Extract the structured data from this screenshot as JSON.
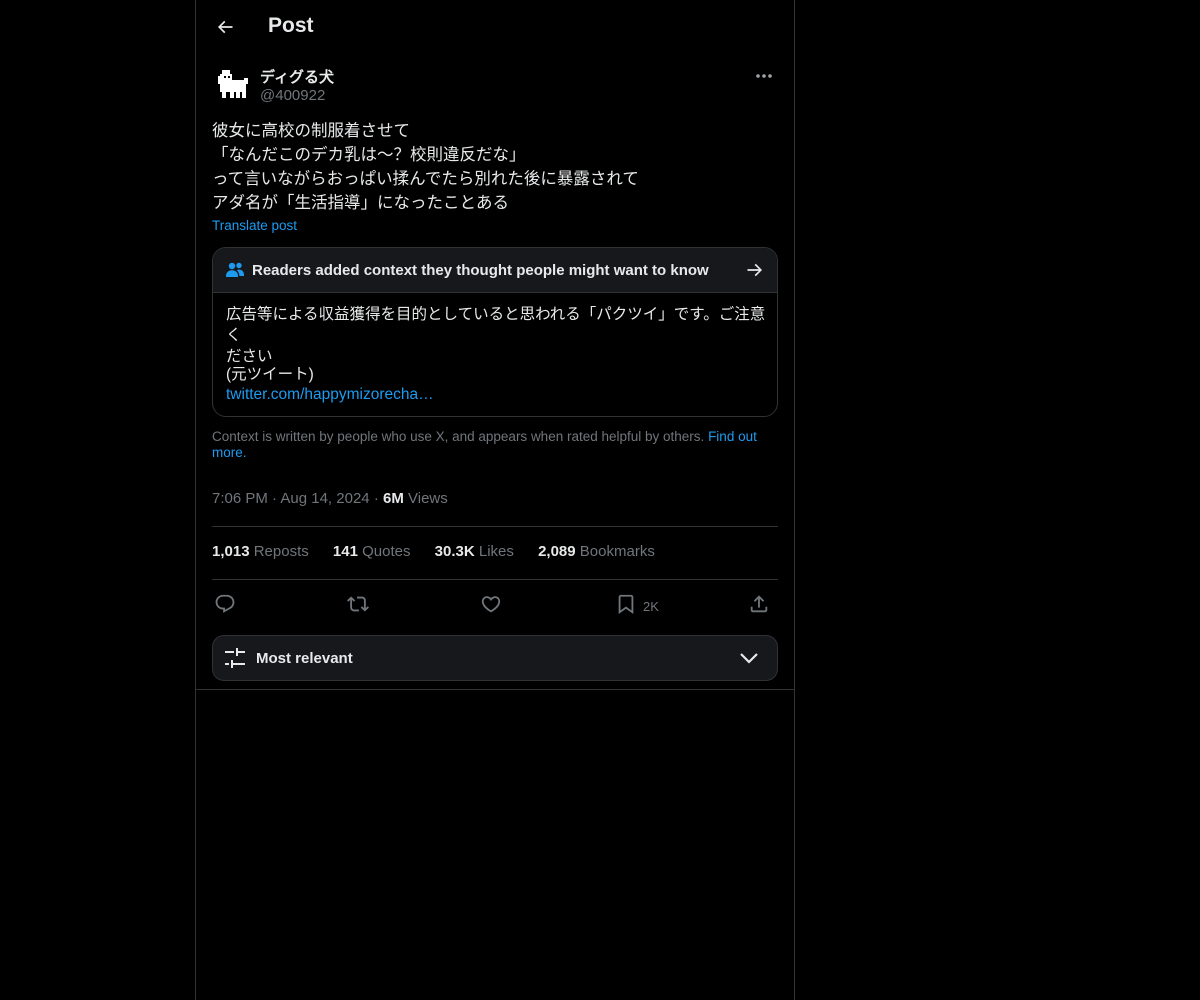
{
  "header": {
    "title": "Post",
    "back_icon": "arrow-left-icon"
  },
  "author": {
    "display_name": "ディグる犬",
    "handle": "@400922",
    "avatar_icon": "pixel-dog-avatar"
  },
  "post": {
    "lines": [
      "彼女に高校の制服着させて",
      "「なんだこのデカ乳は〜？校則違反だな」",
      "って言いながらおっぱい揉んでたら別れた後に暴露されて",
      "アダ名が「生活指導」になったことある"
    ],
    "translate_label": "Translate post"
  },
  "community_note": {
    "header_title": "Readers added context they thought people might want to know",
    "body_line_1": "広告等による収益獲得を目的としていると思われる「パクツイ」です。ご注意く",
    "body_line_2": "ださい",
    "source_label": "(元ツイート)",
    "link_text": "twitter.com/happymizorecha…",
    "info_text": "Context is written by people who use X, and appears when rated helpful by others.",
    "find_out_more": "Find out more."
  },
  "meta": {
    "time": "7:06 PM",
    "sep_1": "·",
    "date": "Aug 14, 2024",
    "sep_2": "·",
    "views_count": "6M",
    "views_label": "Views"
  },
  "stats": [
    {
      "count": "1,013",
      "label": "Reposts"
    },
    {
      "count": "141",
      "label": "Quotes"
    },
    {
      "count": "30.3K",
      "label": "Likes"
    },
    {
      "count": "2,089",
      "label": "Bookmarks"
    }
  ],
  "actions": {
    "bookmark_count": "2K"
  },
  "sort": {
    "label": "Most relevant"
  },
  "colors": {
    "background": "#000000",
    "text": "#e7e9ea",
    "muted": "#71767b",
    "accent": "#1d9bf0",
    "border": "#2f3336",
    "card": "#16181c"
  }
}
